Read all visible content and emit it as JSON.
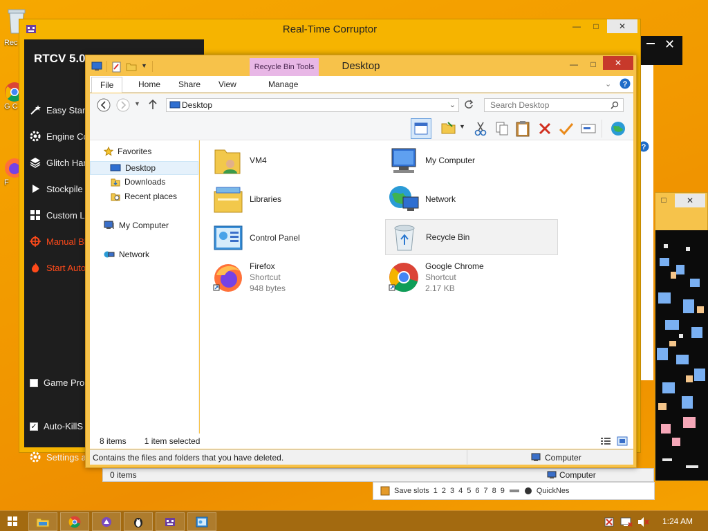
{
  "desktop": {
    "icons": [
      {
        "label": "Rec",
        "icon": "recycle-bin-icon"
      },
      {
        "label": "G C",
        "icon": "chrome-icon"
      },
      {
        "label": "F",
        "icon": "firefox-icon"
      }
    ]
  },
  "rtcv_window": {
    "title": "Real-Time Corruptor",
    "app_name": "RTCV 5.0.",
    "menu": [
      {
        "label": "Easy Start",
        "icon": "wand-icon",
        "style": "normal"
      },
      {
        "label": "Engine Co",
        "icon": "gear-icon",
        "style": "normal"
      },
      {
        "label": "Glitch Har",
        "icon": "layers-icon",
        "style": "normal"
      },
      {
        "label": "Stockpile I",
        "icon": "play-icon",
        "style": "normal"
      },
      {
        "label": "Custom La",
        "icon": "grid-icon",
        "style": "normal"
      },
      {
        "label": "Manual Bl",
        "icon": "crosshair-icon",
        "style": "red"
      },
      {
        "label": "Start Auto",
        "icon": "flame-icon",
        "style": "red"
      }
    ],
    "game_protection_label": "Game Pro",
    "auto_killswitch_label": "Auto-KillS",
    "settings_label": "Settings a"
  },
  "explorer": {
    "title": "Desktop",
    "contextual_tab": "Recycle Bin Tools",
    "tabs": [
      "File",
      "Home",
      "Share",
      "View",
      "Manage"
    ],
    "address": "Desktop",
    "search_placeholder": "Search Desktop",
    "nav": {
      "favorites": "Favorites",
      "favorites_items": [
        "Desktop",
        "Downloads",
        "Recent places"
      ],
      "my_computer": "My Computer",
      "network": "Network"
    },
    "items": [
      {
        "name": "VM4",
        "sub1": "",
        "sub2": "",
        "icon": "user-folder-icon"
      },
      {
        "name": "My Computer",
        "sub1": "",
        "sub2": "",
        "icon": "computer-icon"
      },
      {
        "name": "Libraries",
        "sub1": "",
        "sub2": "",
        "icon": "libraries-icon"
      },
      {
        "name": "Network",
        "sub1": "",
        "sub2": "",
        "icon": "network-icon"
      },
      {
        "name": "Control Panel",
        "sub1": "",
        "sub2": "",
        "icon": "control-panel-icon"
      },
      {
        "name": "Recycle Bin",
        "sub1": "",
        "sub2": "",
        "icon": "recycle-bin-icon"
      },
      {
        "name": "Firefox",
        "sub1": "Shortcut",
        "sub2": "948 bytes",
        "icon": "firefox-icon"
      },
      {
        "name": "Google Chrome",
        "sub1": "Shortcut",
        "sub2": "2.17 KB",
        "icon": "chrome-icon"
      }
    ],
    "status": {
      "count": "8 items",
      "selected": "1 item selected",
      "description": "Contains the files and folders that you have deleted.",
      "location": "Computer"
    }
  },
  "background_explorer": {
    "count": "0 items",
    "location": "Computer"
  },
  "emulator": {
    "save_slots_label": "Save slots",
    "slots": [
      "1",
      "2",
      "3",
      "4",
      "5",
      "6",
      "7",
      "8",
      "9"
    ],
    "quicknes_label": "QuickNes"
  },
  "taskbar": {
    "clock": "1:24 AM"
  },
  "colors": {
    "desktop": "#f29a00",
    "window_frame": "#f7c24a",
    "contextual_tab": "#e8b7e6",
    "rtcv_sidebar": "#1e1e1e",
    "close_red": "#c7392b"
  }
}
